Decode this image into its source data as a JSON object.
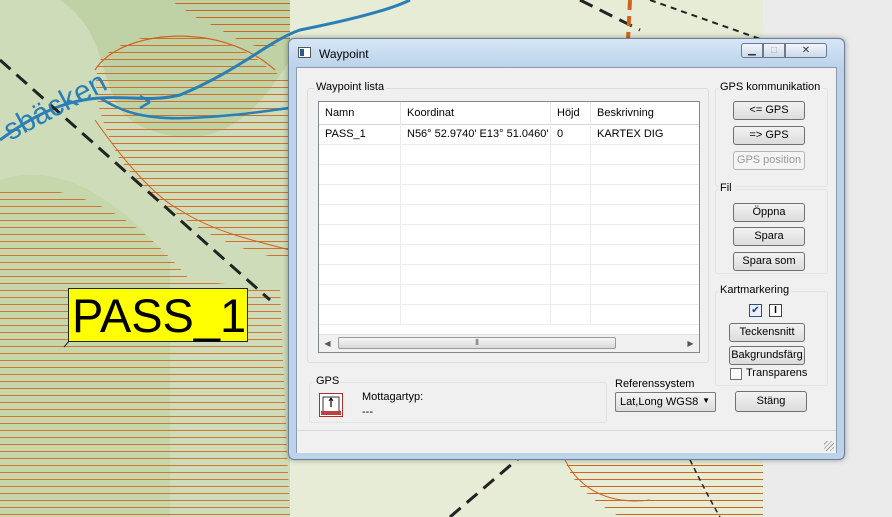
{
  "map": {
    "waypoint_label": "PASS_1",
    "stream_label": "sbäcken"
  },
  "window": {
    "title": "Waypoint",
    "minimize_glyph": "▁",
    "maximize_glyph": "□",
    "close_glyph": "✕"
  },
  "waypoint_list": {
    "title": "Waypoint lista",
    "columns": [
      "Namn",
      "Koordinat",
      "Höjd",
      "Beskrivning"
    ],
    "rows": [
      {
        "namn": "PASS_1",
        "koordinat": "N56° 52.9740' E13° 51.0460'",
        "hojd": "0",
        "beskrivning": "KARTEX DIG"
      }
    ],
    "scroll_left_glyph": "◀",
    "scroll_right_glyph": "▶",
    "scroll_thumb_glyph": "⦀"
  },
  "gps_comm": {
    "title": "GPS kommunikation",
    "buttons": [
      {
        "label": "<= GPS",
        "enabled": true
      },
      {
        "label": "=> GPS",
        "enabled": true
      },
      {
        "label": "GPS position",
        "enabled": false
      }
    ]
  },
  "fil": {
    "title": "Fil",
    "buttons": [
      "Öppna",
      "Spara",
      "Spara som"
    ]
  },
  "kartmarkering": {
    "title": "Kartmarkering",
    "checkbox_checked": true,
    "info_glyph": "I",
    "buttons": [
      "Teckensnitt",
      "Bakgrundsfärg"
    ],
    "transparens_label": "Transparens",
    "transparens_checked": false
  },
  "gps": {
    "title": "GPS",
    "receiver_label": "Mottagartyp:",
    "receiver_value": "---"
  },
  "referenssystem": {
    "label": "Referenssystem",
    "selected": "Lat,Long WGS8",
    "arrow_glyph": "▼"
  },
  "close_button": "Stäng",
  "colors": {
    "map_background": "#e6ecd6",
    "forest_green": "#bcd0a3",
    "contour_orange": "#d0641f",
    "stream_blue": "#2a7fb6",
    "path_black": "#222222",
    "highlight_yellow": "#ffff00",
    "window_frame": "#bcd3ea"
  }
}
